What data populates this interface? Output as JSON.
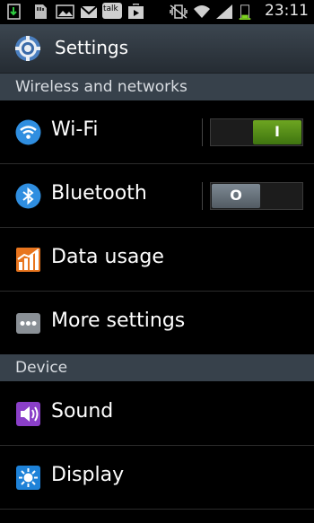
{
  "status_bar": {
    "time": "23:11",
    "talk_label": "talk",
    "left_icons": [
      "download-icon",
      "sd-card-icon",
      "gallery-icon",
      "gmail-icon",
      "talk-icon",
      "play-store-icon"
    ],
    "right_icons": [
      "vibrate-muted-icon",
      "wifi-signal-icon",
      "cell-signal-icon",
      "battery-icon"
    ]
  },
  "header": {
    "title": "Settings"
  },
  "sections": [
    {
      "label": "Wireless and networks"
    },
    {
      "label": "Device"
    }
  ],
  "items": [
    {
      "label": "Wi-Fi",
      "icon": "wifi-icon",
      "toggle": "on",
      "toggle_mark": "I"
    },
    {
      "label": "Bluetooth",
      "icon": "bluetooth-icon",
      "toggle": "off",
      "toggle_mark": "O"
    },
    {
      "label": "Data usage",
      "icon": "data-usage-icon"
    },
    {
      "label": "More settings",
      "icon": "more-settings-icon"
    },
    {
      "label": "Sound",
      "icon": "sound-icon"
    },
    {
      "label": "Display",
      "icon": "display-icon"
    }
  ],
  "colors": {
    "header_bg": "#2e363e",
    "section_bg": "#37414b",
    "toggle_on": "#5a9a1e",
    "toggle_off": "#68737c"
  }
}
